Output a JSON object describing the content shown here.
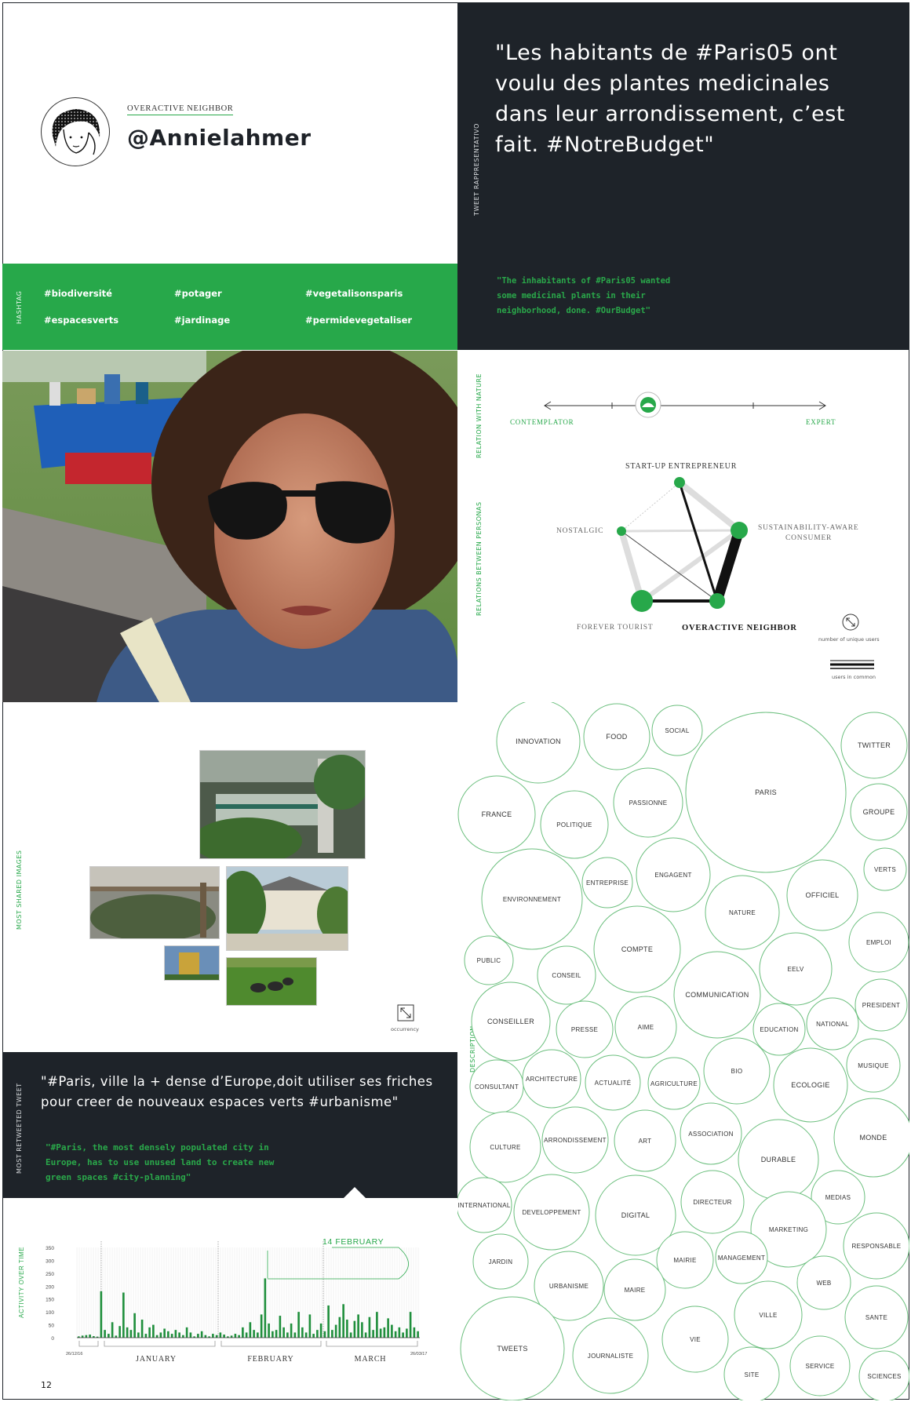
{
  "profile": {
    "persona_label": "OVERACTIVE NEIGHBOR",
    "handle": "@Annielahmer"
  },
  "tweet": {
    "section_label": "TWEET RAPPRESENTATIVO",
    "text_fr": "\"Les habitants de #Paris05 ont voulu des plantes medicinales dans leur arrondissement, c’est fait. #NotreBudget\"",
    "text_en": "\"The inhabitants of #Paris05 wanted some medicinal plants in their neighborhood, done. #OurBudget\""
  },
  "hashtags": {
    "section_label": "HASHTAG",
    "items": [
      "#biodiversité",
      "#potager",
      "#vegetalisonsparis",
      "#espacesverts",
      "#jardinage",
      "#permidevegetaliser"
    ]
  },
  "relation_nature": {
    "section_label": "RELATION WITH NATURE",
    "left_label": "CONTEMPLATOR",
    "right_label": "EXPERT"
  },
  "personas": {
    "section_label": "RELATIONS BETWEEN PERSONAS",
    "nodes": {
      "startup": "START-UP ENTREPRENEUR",
      "sustain_line1": "SUSTAINABILITY-AWARE",
      "sustain_line2": "CONSUMER",
      "nostalgic": "NOSTALGIC",
      "tourist": "FOREVER TOURIST",
      "overactive": "OVERACTIVE NEIGHBOR"
    },
    "legend_unique": "number of unique users",
    "legend_common": "users in common"
  },
  "images": {
    "section_label": "MOST SHARED IMAGES",
    "legend": "occurrency"
  },
  "description": {
    "section_label": "DESCRIPTION",
    "words": [
      "INNOVATION",
      "FOOD",
      "SOCIAL",
      "TWITTER",
      "PARIS",
      "GROUPE",
      "FRANCE",
      "POLITIQUE",
      "PASSIONNE",
      "VERTS",
      "ENVIRONNEMENT",
      "ENTREPRISE",
      "ENGAGENT",
      "OFFICIEL",
      "NATURE",
      "EMPLOI",
      "PUBLIC",
      "CONSEIL",
      "COMPTE",
      "EELV",
      "PRESIDENT",
      "COMMUNICATION",
      "CONSEILLER",
      "PRESSE",
      "AIME",
      "EDUCATION",
      "NATIONAL",
      "MUSIQUE",
      "CONSULTANT",
      "ARCHITECTURE",
      "ACTUALITÉ",
      "AGRICULTURE",
      "BIO",
      "ECOLOGIE",
      "CULTURE",
      "ARRONDISSEMENT",
      "ART",
      "ASSOCIATION",
      "DURABLE",
      "MONDE",
      "MEDIAS",
      "INTERNATIONAL",
      "DEVELOPPEMENT",
      "DIGITAL",
      "DIRECTEUR",
      "MARKETING",
      "RESPONSABLE",
      "JARDIN",
      "URBANISME",
      "MAIRIE",
      "MANAGEMENT",
      "WEB",
      "MAIRE",
      "VILLE",
      "SANTE",
      "TWEETS",
      "VIE",
      "JOURNALISTE",
      "SITE",
      "SERVICE",
      "SCIENCES"
    ]
  },
  "retweet": {
    "section_label": "MOST RETWEETED TWEET",
    "text_fr": "\"#Paris, ville la + dense d’Europe,doit utiliser ses friches pour creer de nouveaux espaces verts #urbanisme\"",
    "text_en": "\"#Paris, the most densely populated city in Europe, has to use unused land to create new green spaces #city-planning\""
  },
  "chart_data": {
    "type": "bar",
    "ylabel": "ACTIVITY OVER TIME",
    "ylim": [
      0,
      350
    ],
    "yticks": [
      "0",
      "50",
      "100",
      "150",
      "200",
      "250",
      "300",
      "350"
    ],
    "months": [
      "JANUARY",
      "FEBRUARY",
      "MARCH"
    ],
    "start_date": "26/12/16",
    "end_date": "26/03/17",
    "annotation": "14 FEBRUARY",
    "values": [
      5,
      8,
      10,
      12,
      6,
      4,
      180,
      30,
      15,
      60,
      8,
      45,
      175,
      40,
      30,
      95,
      20,
      70,
      15,
      40,
      50,
      10,
      20,
      35,
      25,
      15,
      30,
      20,
      10,
      40,
      20,
      5,
      15,
      25,
      10,
      5,
      15,
      10,
      20,
      12,
      5,
      8,
      15,
      10,
      40,
      20,
      60,
      30,
      20,
      90,
      230,
      55,
      25,
      30,
      85,
      40,
      20,
      55,
      20,
      100,
      40,
      20,
      90,
      15,
      30,
      55,
      25,
      125,
      30,
      50,
      80,
      130,
      70,
      20,
      65,
      90,
      60,
      20,
      80,
      30,
      100,
      35,
      40,
      75,
      50,
      25,
      40,
      20,
      35,
      100,
      40,
      25
    ]
  },
  "page_number": "12"
}
